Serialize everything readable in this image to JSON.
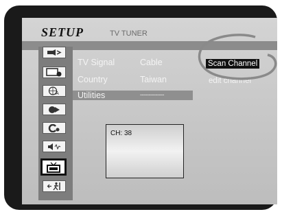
{
  "header": {
    "title": "SETUP",
    "subtitle": "TV TUNER"
  },
  "sidebar": {
    "items": [
      {
        "icon": "audio-out-icon",
        "selected": false
      },
      {
        "icon": "video-settings-icon",
        "selected": false
      },
      {
        "icon": "language-icon",
        "selected": false
      },
      {
        "icon": "play-icon",
        "selected": false
      },
      {
        "icon": "repeat-icon",
        "selected": false
      },
      {
        "icon": "speaker-icon",
        "selected": false
      },
      {
        "icon": "tv-icon",
        "selected": true
      },
      {
        "icon": "exit-icon",
        "selected": false
      }
    ]
  },
  "menu": {
    "rows": [
      {
        "label": "TV Signal",
        "value": "Cable"
      },
      {
        "label": "Country",
        "value": "Taiwan"
      },
      {
        "label": "Utilities",
        "value": "--------------"
      }
    ]
  },
  "preview": {
    "channel": "CH: 38"
  },
  "submenu": {
    "scan": "Scan Channel",
    "edit": "edit channel"
  },
  "colors": {
    "bezel": "#1a1a1a",
    "highlight": "#8f8f8f",
    "sidebar": "#7d7d7d",
    "selection": "#111111"
  }
}
